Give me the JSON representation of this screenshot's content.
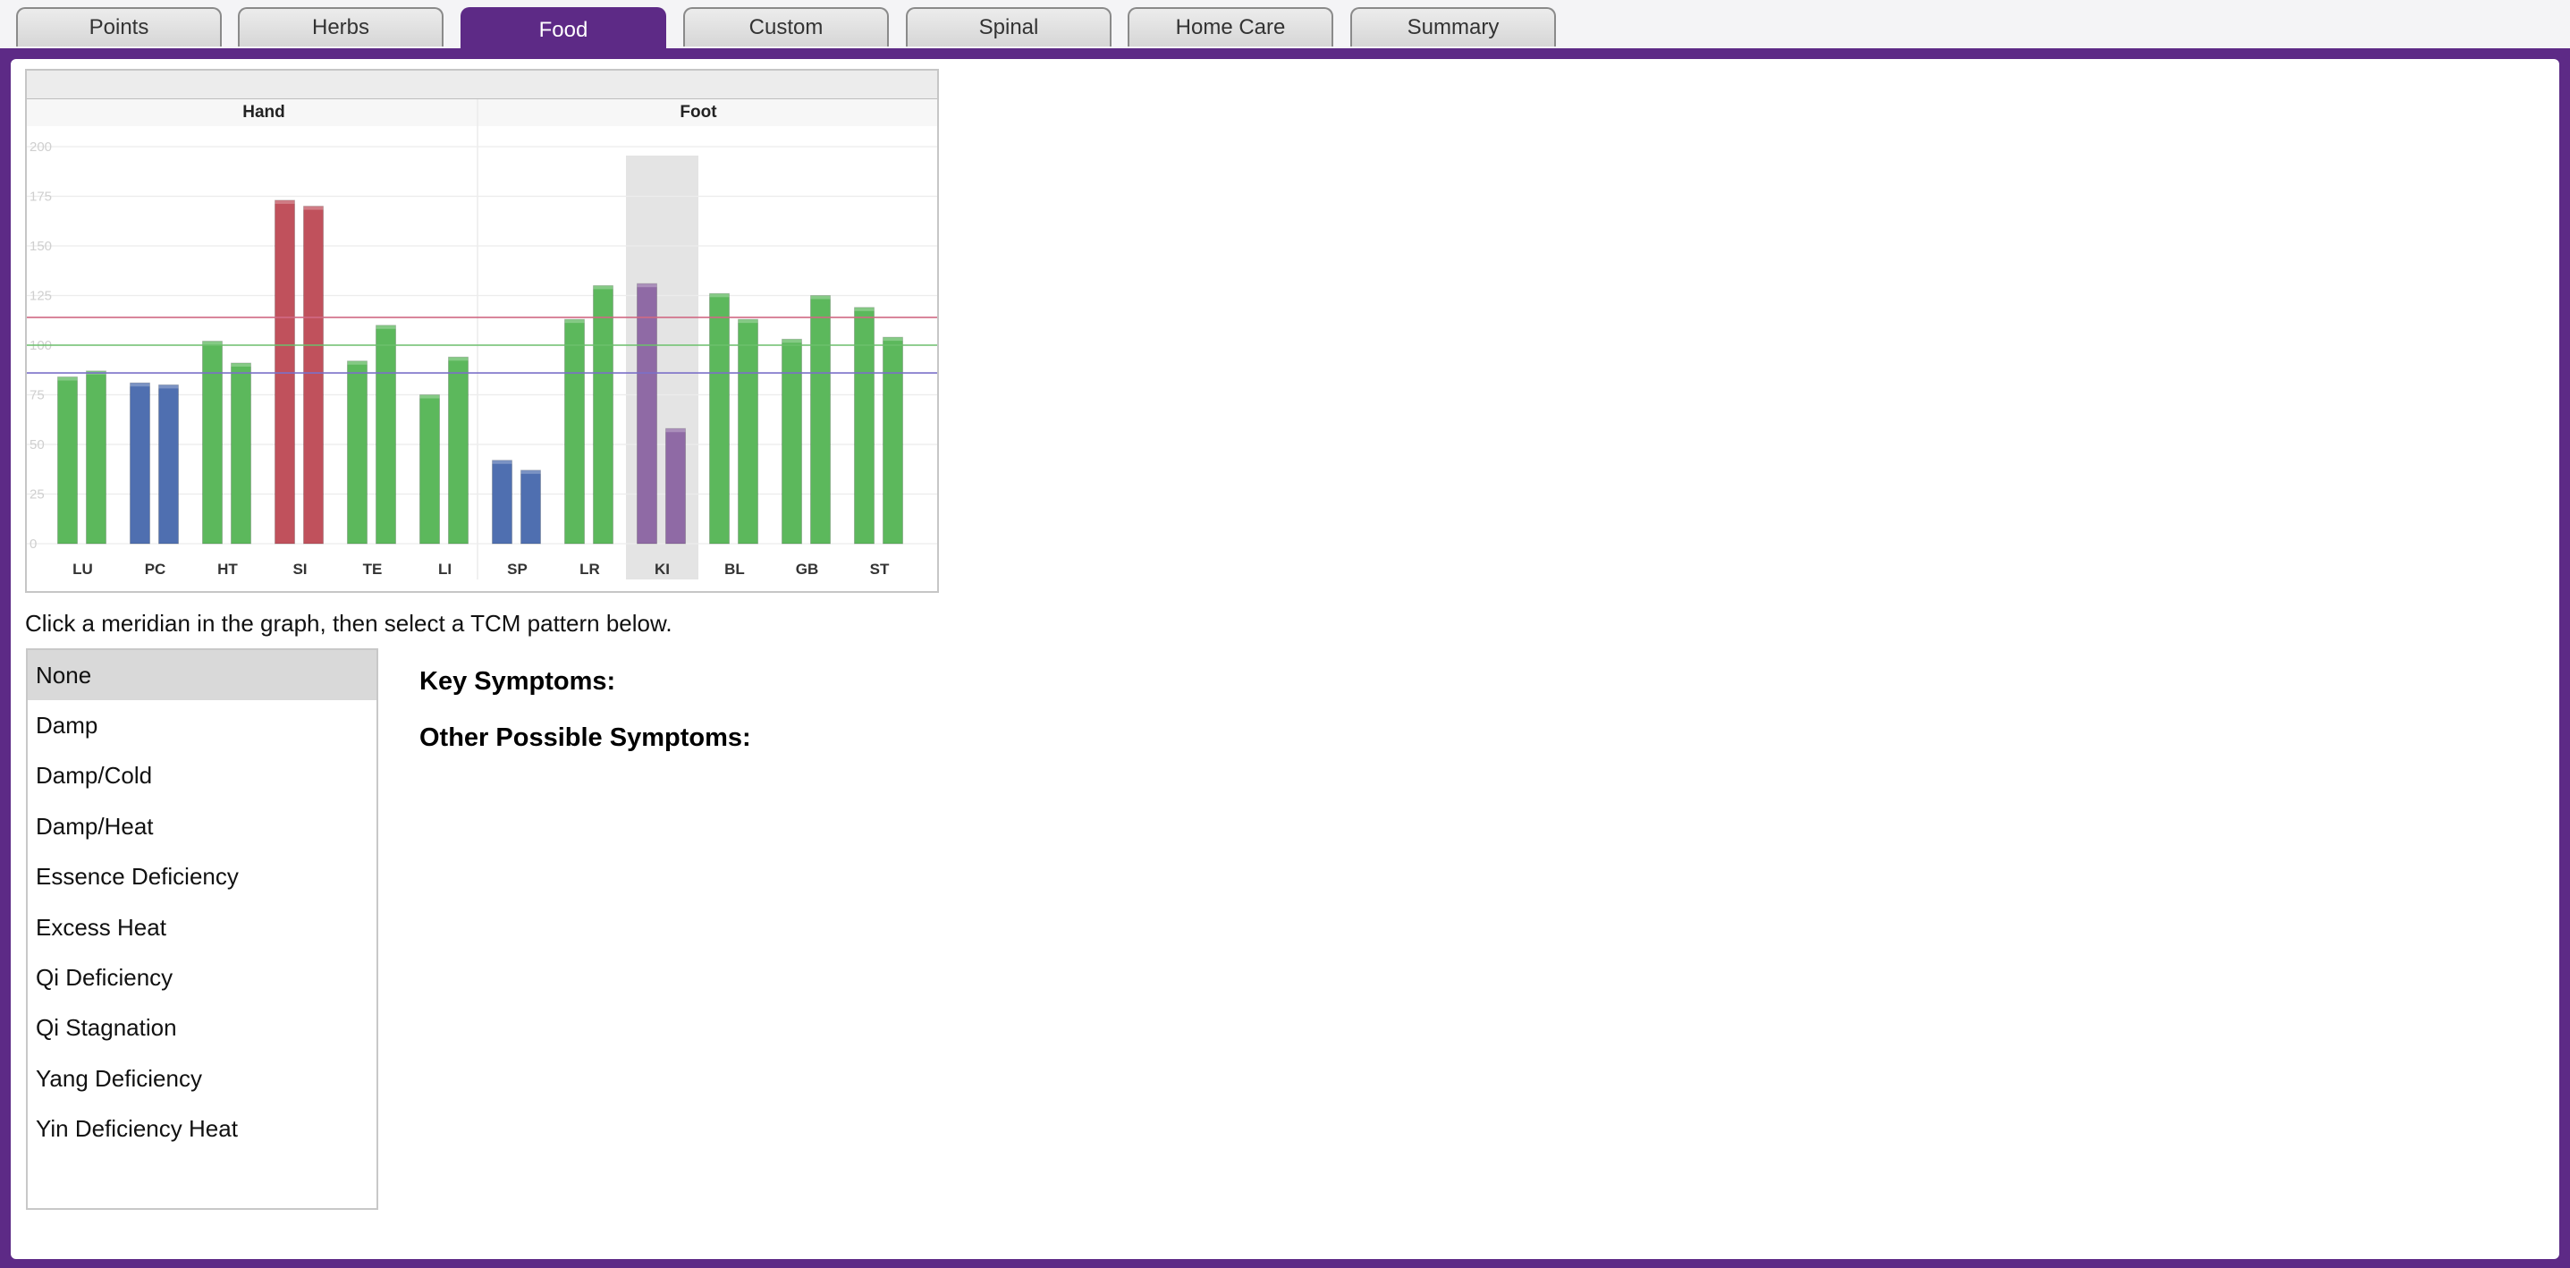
{
  "tabs": [
    {
      "label": "Points",
      "active": false
    },
    {
      "label": "Herbs",
      "active": false
    },
    {
      "label": "Food",
      "active": true
    },
    {
      "label": "Custom",
      "active": false
    },
    {
      "label": "Spinal",
      "active": false
    },
    {
      "label": "Home Care",
      "active": false
    },
    {
      "label": "Summary",
      "active": false
    }
  ],
  "colors": {
    "accent": "#5d2a86",
    "bar_green": "#5cb85c",
    "bar_blue": "#4f6fb0",
    "bar_red": "#c0515c",
    "bar_purple": "#8f6aa5",
    "line_red": "#d06a84",
    "line_green": "#6cc06c",
    "line_blue": "#7b70c8"
  },
  "chart_data": {
    "type": "bar",
    "groups": [
      "Hand",
      "Foot"
    ],
    "categories": [
      "LU",
      "PC",
      "HT",
      "SI",
      "TE",
      "LI",
      "SP",
      "LR",
      "KI",
      "BL",
      "GB",
      "ST"
    ],
    "series": [
      {
        "values": [
          84,
          81,
          102,
          173,
          92,
          75,
          42,
          113,
          131,
          126,
          103,
          119
        ]
      },
      {
        "values": [
          87,
          80,
          91,
          170,
          110,
          94,
          37,
          130,
          58,
          113,
          125,
          104
        ]
      }
    ],
    "bar_colors": [
      "green",
      "blue",
      "green",
      "red",
      "green",
      "green",
      "blue",
      "green",
      "purple",
      "green",
      "green",
      "green"
    ],
    "reference_lines": [
      {
        "value": 114,
        "color": "red"
      },
      {
        "value": 100,
        "color": "green"
      },
      {
        "value": 86,
        "color": "blue"
      }
    ],
    "y_ticks": [
      0,
      25,
      50,
      75,
      100,
      125,
      150,
      175,
      200
    ],
    "ylim": [
      0,
      200
    ],
    "selected_category": "KI",
    "grid": true
  },
  "instruction_text": "Click a meridian in the graph, then select a TCM pattern below.",
  "patterns": [
    {
      "label": "None",
      "selected": true
    },
    {
      "label": "Damp",
      "selected": false
    },
    {
      "label": "Damp/Cold",
      "selected": false
    },
    {
      "label": "Damp/Heat",
      "selected": false
    },
    {
      "label": "Essence Deficiency",
      "selected": false
    },
    {
      "label": "Excess Heat",
      "selected": false
    },
    {
      "label": "Qi Deficiency",
      "selected": false
    },
    {
      "label": "Qi Stagnation",
      "selected": false
    },
    {
      "label": "Yang Deficiency",
      "selected": false
    },
    {
      "label": "Yin Deficiency Heat",
      "selected": false
    }
  ],
  "symptoms": {
    "key_label": "Key Symptoms:",
    "other_label": "Other Possible Symptoms:"
  }
}
